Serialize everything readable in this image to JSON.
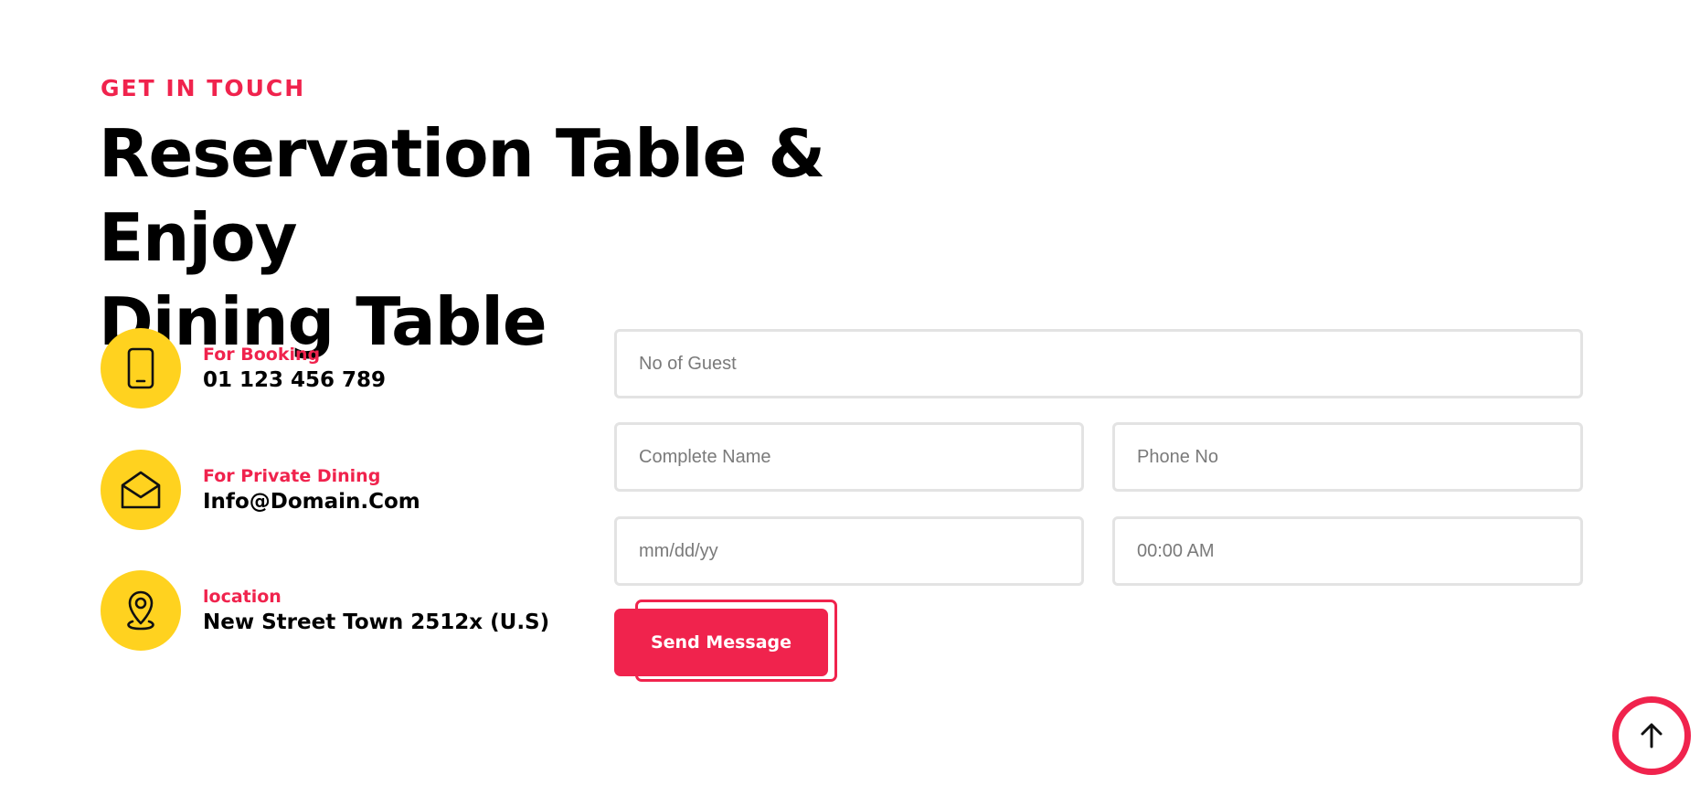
{
  "section": {
    "eyebrow": "GET IN TOUCH",
    "title_line1": "Reservation Table & Enjoy",
    "title_line2": "Dining Table"
  },
  "contacts": [
    {
      "icon": "phone-icon",
      "label": "For Booking",
      "value": "01 123 456 789"
    },
    {
      "icon": "envelope-icon",
      "label": "For Private Dining",
      "value": "Info@Domain.Com"
    },
    {
      "icon": "location-pin-icon",
      "label": "location",
      "value": "New Street Town 2512x (U.S)"
    }
  ],
  "form": {
    "guests_placeholder": "No of Guest",
    "name_placeholder": "Complete Name",
    "phone_placeholder": "Phone No",
    "date_placeholder": "mm/dd/yy",
    "time_placeholder": "00:00 AM",
    "submit_label": "Send Message"
  },
  "colors": {
    "accent": "#f0234d",
    "icon_bg": "#ffd21f",
    "field_border": "#e3e3e3"
  },
  "scroll_top": {
    "icon": "arrow-up-icon"
  }
}
